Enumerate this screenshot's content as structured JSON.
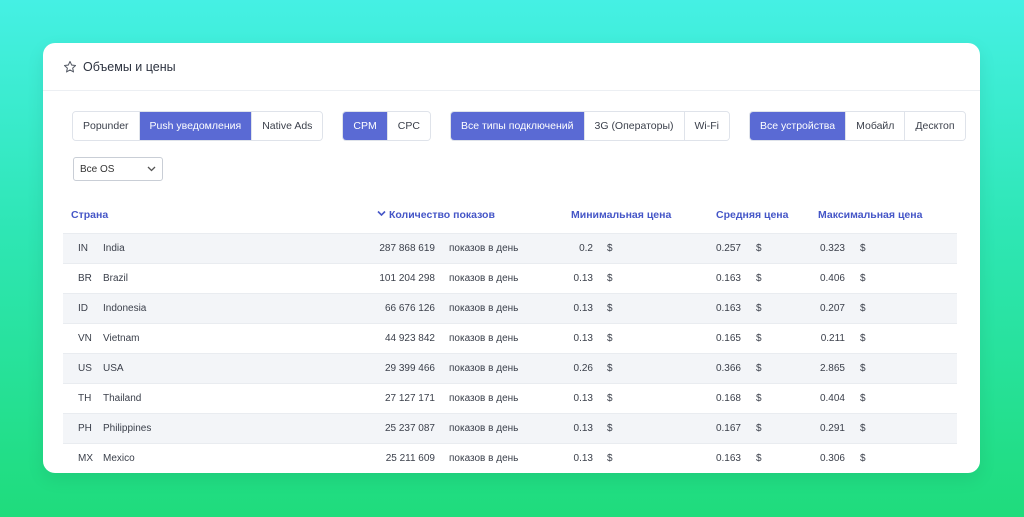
{
  "header": {
    "title": "Объемы и цены",
    "icon": "star-icon"
  },
  "filters": {
    "ad_formats": [
      {
        "label": "Popunder",
        "active": false
      },
      {
        "label": "Push уведомления",
        "active": true
      },
      {
        "label": "Native Ads",
        "active": false
      }
    ],
    "pricing": [
      {
        "label": "CPM",
        "active": true
      },
      {
        "label": "CPC",
        "active": false
      }
    ],
    "connection": [
      {
        "label": "Все типы подключений",
        "active": true
      },
      {
        "label": "3G (Операторы)",
        "active": false
      },
      {
        "label": "Wi-Fi",
        "active": false
      }
    ],
    "devices": [
      {
        "label": "Все устройства",
        "active": true
      },
      {
        "label": "Мобайл",
        "active": false
      },
      {
        "label": "Десктоп",
        "active": false
      }
    ],
    "os_select": {
      "value": "Все OS"
    }
  },
  "table": {
    "headers": {
      "country": "Страна",
      "count": "Количество показов",
      "min": "Минимальная цена",
      "avg": "Средняя цена",
      "max": "Максимальная цена"
    },
    "rows": [
      {
        "code": "IN",
        "name": "India",
        "count": "287 868 619",
        "unit": "показов в день",
        "min": "0.2",
        "avg": "0.257",
        "max": "0.323",
        "currency": "$"
      },
      {
        "code": "BR",
        "name": "Brazil",
        "count": "101 204 298",
        "unit": "показов в день",
        "min": "0.13",
        "avg": "0.163",
        "max": "0.406",
        "currency": "$"
      },
      {
        "code": "ID",
        "name": "Indonesia",
        "count": "66 676 126",
        "unit": "показов в день",
        "min": "0.13",
        "avg": "0.163",
        "max": "0.207",
        "currency": "$"
      },
      {
        "code": "VN",
        "name": "Vietnam",
        "count": "44 923 842",
        "unit": "показов в день",
        "min": "0.13",
        "avg": "0.165",
        "max": "0.211",
        "currency": "$"
      },
      {
        "code": "US",
        "name": "USA",
        "count": "29 399 466",
        "unit": "показов в день",
        "min": "0.26",
        "avg": "0.366",
        "max": "2.865",
        "currency": "$"
      },
      {
        "code": "TH",
        "name": "Thailand",
        "count": "27 127 171",
        "unit": "показов в день",
        "min": "0.13",
        "avg": "0.168",
        "max": "0.404",
        "currency": "$"
      },
      {
        "code": "PH",
        "name": "Philippines",
        "count": "25 237 087",
        "unit": "показов в день",
        "min": "0.13",
        "avg": "0.167",
        "max": "0.291",
        "currency": "$"
      },
      {
        "code": "MX",
        "name": "Mexico",
        "count": "25 211 609",
        "unit": "показов в день",
        "min": "0.13",
        "avg": "0.163",
        "max": "0.306",
        "currency": "$"
      }
    ]
  }
}
